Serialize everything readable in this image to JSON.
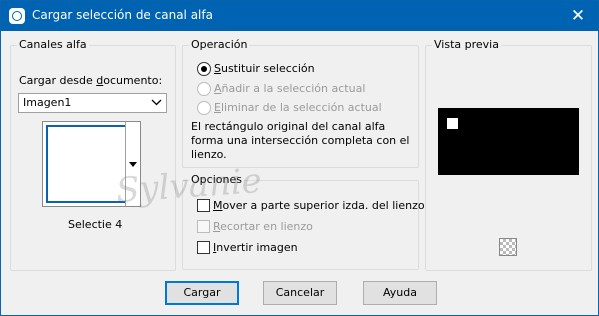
{
  "window": {
    "title": "Cargar selección de canal alfa",
    "close_glyph": "✕"
  },
  "channels": {
    "group_title": "Canales alfa",
    "load_label_prefix": "Cargar desde ",
    "load_label_underlined": "d",
    "load_label_suffix": "ocumento:",
    "document": "Imagen1",
    "channel_name": "Selectie 4"
  },
  "operation": {
    "group_title": "Operación",
    "options": [
      {
        "underlined": "S",
        "rest": "ustituir selección",
        "checked": true,
        "enabled": true
      },
      {
        "underlined": "A",
        "rest": "ñadir a la selección actual",
        "checked": false,
        "enabled": false
      },
      {
        "underlined": "E",
        "rest": "liminar de la selección actual",
        "checked": false,
        "enabled": false
      }
    ],
    "info": "El rectángulo original del canal alfa forma una intersección completa con el lienzo."
  },
  "options": {
    "group_title": "Opciones",
    "checkboxes": [
      {
        "underlined": "M",
        "rest": "over a parte superior izda. del lienzo",
        "checked": false,
        "enabled": true
      },
      {
        "underlined": "R",
        "rest": "ecortar en lienzo",
        "checked": false,
        "enabled": false
      },
      {
        "underlined": "I",
        "rest": "nvertir imagen",
        "checked": false,
        "enabled": true
      }
    ]
  },
  "preview": {
    "group_title": "Vista previa",
    "icon": "checkerboard-icon"
  },
  "buttons": {
    "load": "Cargar",
    "cancel": "Cancelar",
    "help": "Ayuda"
  },
  "watermark": "Sylvanie",
  "colors": {
    "titlebar": "#0063b1",
    "accent": "#0078d7",
    "preview_bg": "#000000"
  }
}
